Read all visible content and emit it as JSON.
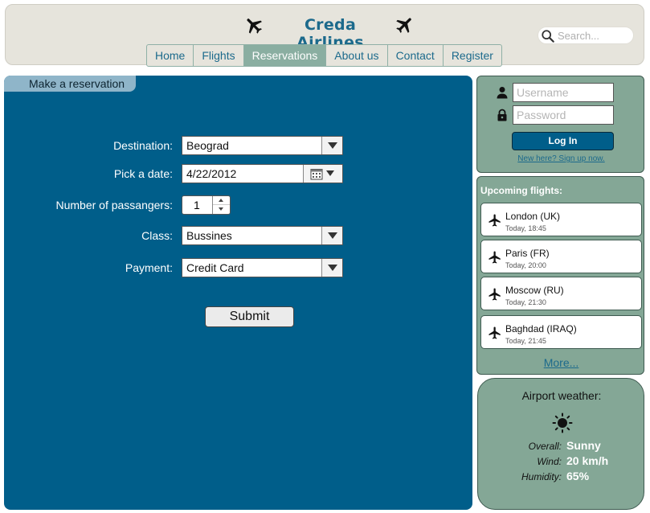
{
  "header": {
    "title": "Creda Airlines",
    "search_placeholder": "Search...",
    "nav": [
      {
        "label": "Home",
        "active": false
      },
      {
        "label": "Flights",
        "active": false
      },
      {
        "label": "Reservations",
        "active": true
      },
      {
        "label": "About us",
        "active": false
      },
      {
        "label": "Contact",
        "active": false
      },
      {
        "label": "Register",
        "active": false
      }
    ]
  },
  "reservation": {
    "tab_title": "Make a reservation",
    "destination": {
      "label": "Destination:",
      "value": "Beograd"
    },
    "date": {
      "label": "Pick a date:",
      "value": "4/22/2012"
    },
    "passengers": {
      "label": "Number of passangers:",
      "value": "1"
    },
    "class": {
      "label": "Class:",
      "value": "Bussines"
    },
    "payment": {
      "label": "Payment:",
      "value": "Credit Card"
    },
    "submit_label": "Submit"
  },
  "login": {
    "username_placeholder": "Username",
    "password_placeholder": "Password",
    "button_label": "Log In",
    "signup_link": "New here? Sign up now."
  },
  "upcoming": {
    "title": "Upcoming flights:",
    "flights": [
      {
        "city": "London (UK)",
        "time": "Today, 18:45"
      },
      {
        "city": "Paris (FR)",
        "time": "Today, 20:00"
      },
      {
        "city": "Moscow (RU)",
        "time": "Today, 21:30"
      },
      {
        "city": "Baghdad (IRAQ)",
        "time": "Today, 21:45"
      }
    ],
    "more_link": "More..."
  },
  "weather": {
    "title": "Airport weather:",
    "icon": "sun-icon",
    "overall": {
      "label": "Overall:",
      "value": "Sunny"
    },
    "wind": {
      "label": "Wind:",
      "value": "20 km/h"
    },
    "humidity": {
      "label": "Humidity:",
      "value": "65%"
    }
  },
  "colors": {
    "main_panel": "#005e8a",
    "sidebar_panels": "#84a796",
    "header_bg": "#e6e4dc",
    "brand_text": "#1c6a8c",
    "active_nav": "#8aaea1"
  }
}
